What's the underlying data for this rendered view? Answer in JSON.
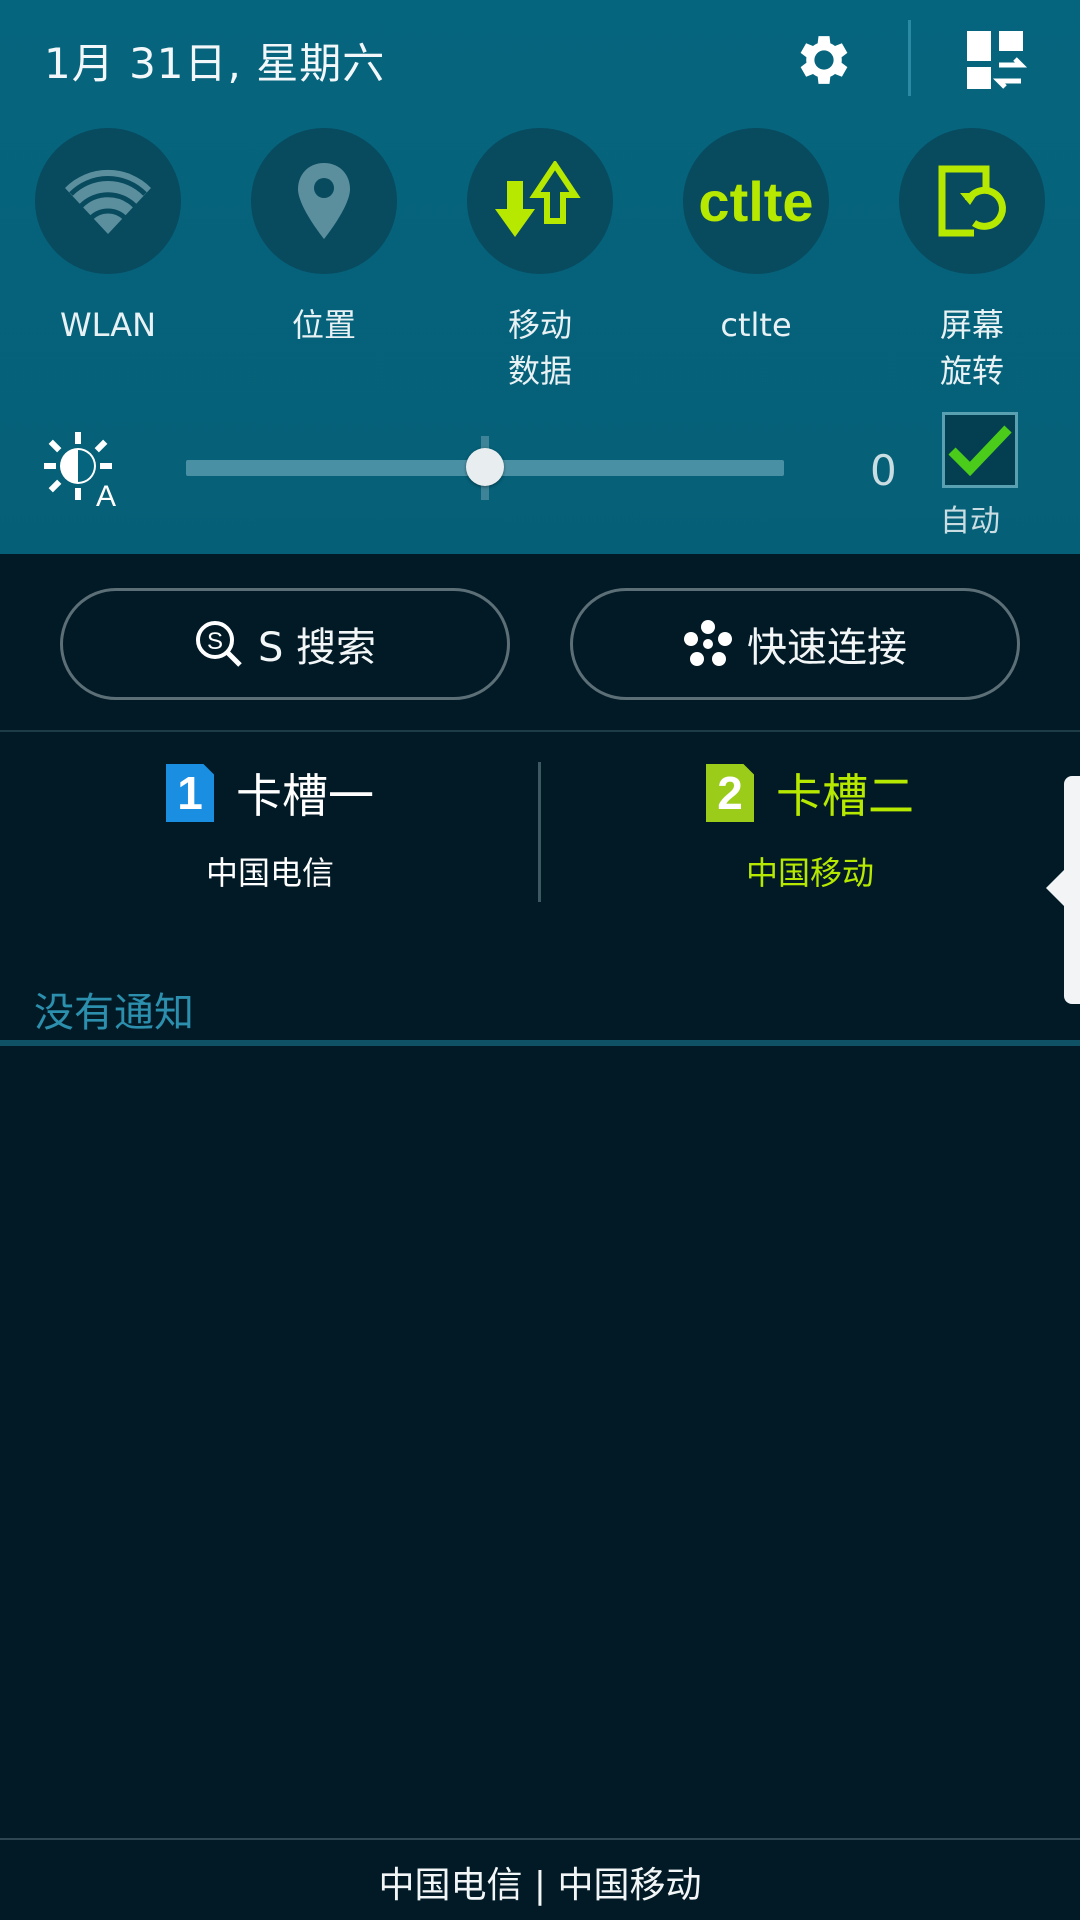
{
  "header": {
    "datetime": "1月 31日, 星期六"
  },
  "toggles": [
    {
      "label": "WLAN",
      "icon": "wifi-icon",
      "active": false
    },
    {
      "label": "位置",
      "icon": "location-icon",
      "active": false
    },
    {
      "label": "移动\n数据",
      "icon": "mobile-data-icon",
      "active": true
    },
    {
      "label": "ctlte",
      "icon_text": "ctlte",
      "active": true
    },
    {
      "label": "屏幕\n旋转",
      "icon": "screen-rotation-icon",
      "active": true
    }
  ],
  "brightness": {
    "value": "0",
    "level": 0.5,
    "auto_label": "自动",
    "auto_checked": true
  },
  "actions": {
    "s_search": "S 搜索",
    "quick_connect": "快速连接"
  },
  "sims": [
    {
      "badge": "1",
      "title": "卡槽一",
      "carrier": "中国电信",
      "color": "#1a8ee0",
      "text_color": "#ffffff"
    },
    {
      "badge": "2",
      "title": "卡槽二",
      "carrier": "中国移动",
      "color": "#9ccc1a",
      "text_color": "#b6e800"
    }
  ],
  "notifications": {
    "empty_text": "没有通知"
  },
  "footer": {
    "carriers": "中国电信 | 中国移动"
  },
  "colors": {
    "accent_green": "#b6e800",
    "panel_bg": "#06657e",
    "body_bg": "#011a26"
  }
}
